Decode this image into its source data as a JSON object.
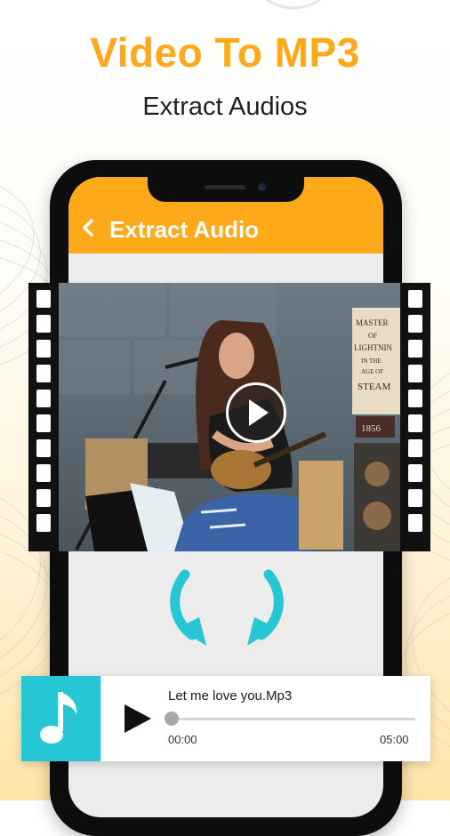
{
  "promo": {
    "headline": "Video To MP3",
    "subheadline": "Extract Audios"
  },
  "app_bar": {
    "title": "Extract Audio",
    "back_icon": "chevron-left-icon"
  },
  "video": {
    "play_icon": "play-icon",
    "poster_lines": [
      "MASTER",
      "OF",
      "LIGHTNIN",
      "IN THE",
      "AGE OF",
      "STEAM",
      "1856"
    ]
  },
  "conversion": {
    "arrow_icon": "curved-arrow-down-icon",
    "arrow_color": "#27c6d4"
  },
  "audio_player": {
    "track_name": "Let me love you.Mp3",
    "current_time": "00:00",
    "duration": "05:00",
    "progress": 0,
    "music_icon": "music-note-icon",
    "tile_color": "#27c6d4",
    "play_icon": "play-icon"
  },
  "colors": {
    "accent": "#fda91a",
    "teal": "#27c6d4"
  }
}
